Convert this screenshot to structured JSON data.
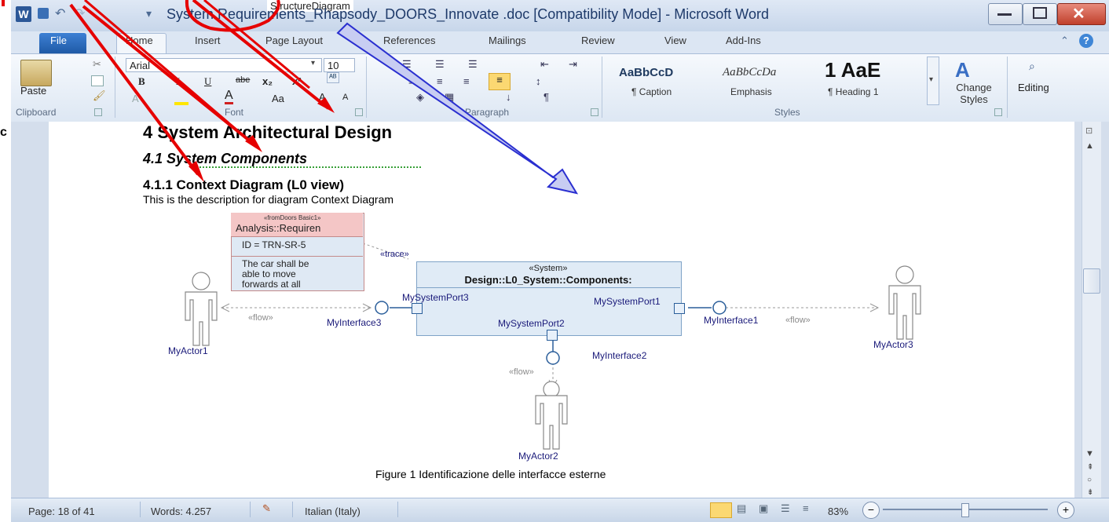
{
  "window": {
    "title": "System Requirements_Rhapsody_DOORS_Innovate .doc [Compatibility Mode]  -  Microsoft Word",
    "behind_text": "StructureDiagram",
    "left_edge_text": "c"
  },
  "tabs": [
    "File",
    "Home",
    "Insert",
    "Page Layout",
    "References",
    "Mailings",
    "Review",
    "View",
    "Add-Ins"
  ],
  "ribbon": {
    "paste_label": "Paste",
    "font_name": "Arial",
    "font_size": "10",
    "groups": [
      "Clipboard",
      "Font",
      "Paragraph",
      "Styles"
    ],
    "styles": [
      {
        "preview": "AaBbCcD",
        "name": "¶ Caption"
      },
      {
        "preview": "AaBbCcDa",
        "name": "Emphasis"
      },
      {
        "preview": "1  AaE",
        "name": "¶ Heading 1"
      }
    ],
    "change_styles": "Change Styles",
    "editing": "Editing"
  },
  "document": {
    "h1": "4   System Architectural  Design",
    "h2": "4.1  System Components",
    "h3": "4.1.1  Context Diagram (L0 view)",
    "body": "This is the description for diagram Context Diagram",
    "caption": "Figure 1 Identificazione delle interfacce esterne"
  },
  "diagram": {
    "requirement": {
      "stereotype": "«fromDoors Basic1»",
      "title": "Analysis::Requiren",
      "id": "ID = TRN-SR-5",
      "text": [
        "The car shall be",
        "able to move",
        "forwards at all"
      ]
    },
    "trace_label": "«trace»",
    "system": {
      "stereotype": "«System»",
      "name": "Design::L0_System::Components:"
    },
    "ports": [
      "MySystemPort3",
      "MySystemPort1",
      "MySystemPort2"
    ],
    "interfaces": [
      "MyInterface3",
      "MyInterface1",
      "MyInterface2"
    ],
    "actors": [
      "MyActor1",
      "MyActor3",
      "MyActor2"
    ],
    "flow_label": "«flow»"
  },
  "status": {
    "page": "Page: 18 of 41",
    "words": "Words: 4.257",
    "language": "Italian (Italy)",
    "zoom": "83%"
  },
  "colors": {
    "annotation_red": "#e60000",
    "annotation_arrow_fill": "#c8cdf2",
    "annotation_arrow_stroke": "#2a2fd0"
  }
}
